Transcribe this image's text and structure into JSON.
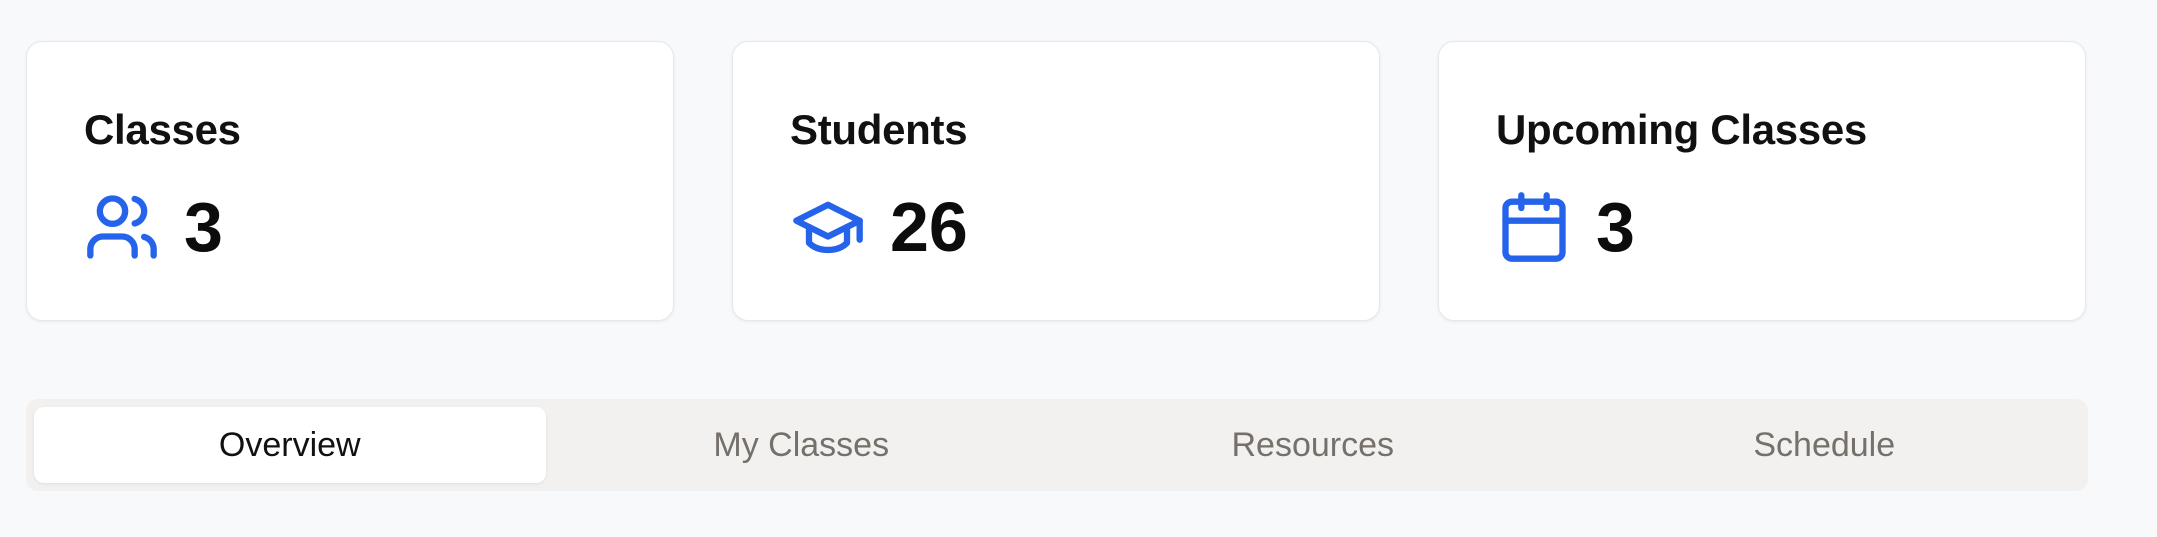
{
  "stats": [
    {
      "title": "Classes",
      "value": "3",
      "icon": "users-icon"
    },
    {
      "title": "Students",
      "value": "26",
      "icon": "graduation-cap-icon"
    },
    {
      "title": "Upcoming Classes",
      "value": "3",
      "icon": "calendar-icon"
    }
  ],
  "tabs": [
    {
      "label": "Overview",
      "active": true
    },
    {
      "label": "My Classes",
      "active": false
    },
    {
      "label": "Resources",
      "active": false
    },
    {
      "label": "Schedule",
      "active": false
    }
  ],
  "colors": {
    "accent": "#2563eb",
    "background": "#f8f9fa",
    "card": "#ffffff",
    "tab_bar": "#f2f1ef",
    "tab_inactive_text": "#76706b"
  }
}
